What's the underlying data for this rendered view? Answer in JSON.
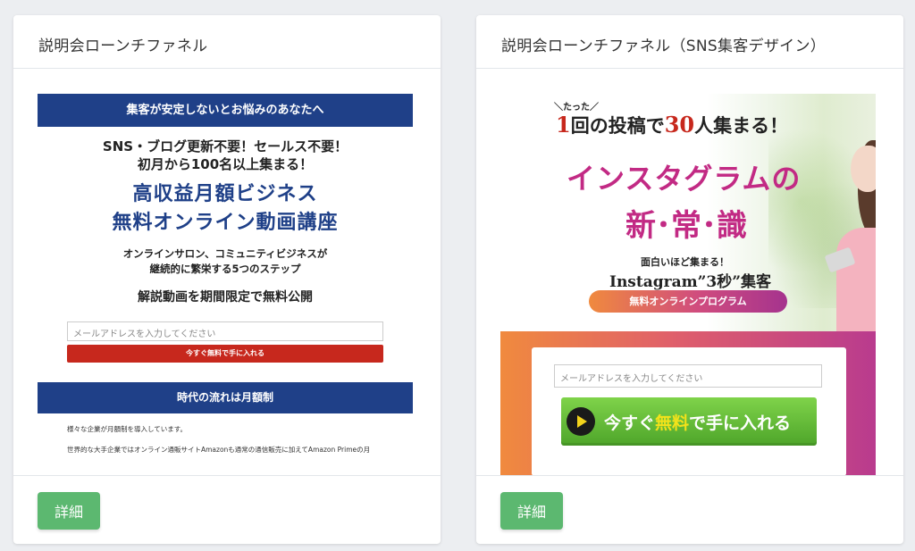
{
  "cards": [
    {
      "title": "説明会ローンチファネル",
      "detail_label": "詳細",
      "preview": {
        "band1": "集客が安定しないとお悩みのあなたへ",
        "line1": "SNS・ブログ更新不要！セールス不要！",
        "line2": "初月から100名以上集まる！",
        "big1": "高収益月額ビジネス",
        "big2": "無料オンライン動画講座",
        "small1": "オンラインサロン、コミュニティビジネスが",
        "small2": "継続的に繁栄する5つのステップ",
        "publish": "解説動画を期間限定で無料公開",
        "email_placeholder": "メールアドレスを入力してください",
        "cta": "今すぐ無料で手に入れる",
        "band2": "時代の流れは月額制",
        "text1": "様々な企業が月額制を導入しています。",
        "text2": "世界的な大手企業ではオンライン通販サイトAmazonも通常の通信販売に加えてAmazon Primeの月"
      }
    },
    {
      "title": "説明会ローンチファネル（SNS集客デザイン）",
      "detail_label": "詳細",
      "preview": {
        "tatta": "＼たった／",
        "hl_num1": "1",
        "hl_mid": "回の投稿で",
        "hl_num2": "30",
        "hl_end": "人集まる！",
        "insta": "インスタグラムの",
        "shin": "新･常･識",
        "omoshiroi": "面白いほど集まる！",
        "ig3": "Instagram”3秒”集客",
        "pill": "無料オンラインプログラム",
        "email_placeholder": "メールアドレスを入力してください",
        "cta_pre": "今すぐ",
        "cta_mid": "無料",
        "cta_post": "で手に入れる"
      }
    }
  ],
  "colors": {
    "navy": "#1f4088",
    "red": "#c7281d",
    "green_button": "#5cb870",
    "magenta": "#c22a84"
  }
}
